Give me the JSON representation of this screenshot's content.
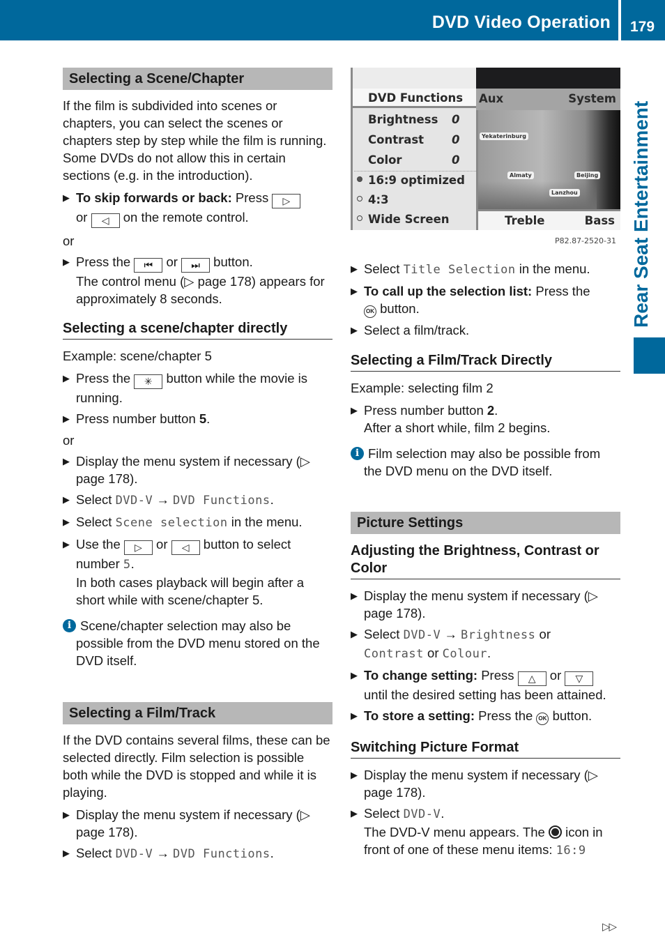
{
  "header": {
    "title": "DVD Video Operation",
    "page_number": "179"
  },
  "side_tab": {
    "label": "Rear Seat Entertainment"
  },
  "colors": {
    "brand": "#00689c",
    "section_bg": "#b7b7b7"
  },
  "left": {
    "scene_section": {
      "heading": "Selecting a Scene/Chapter",
      "intro": "If the film is subdivided into scenes or chapters, you can select the scenes or chapters step by step while the film is running. Some DVDs do not allow this in certain sections (e.g. in the introduction).",
      "skip_bold": "To skip forwards or back:",
      "skip_press": "Press",
      "skip_or": "or",
      "skip_tail": "on the remote control.",
      "key_next": "▷",
      "key_prev": "◁",
      "or1": "or",
      "press_the": "Press the",
      "key_skip_back": "⏮",
      "mid_or": "or",
      "key_skip_fwd": "⏭",
      "button_word": "button.",
      "control_menu": "The control menu (▷ page 178) appears for approximately 8 seconds."
    },
    "direct_section": {
      "heading": "Selecting a scene/chapter directly",
      "example": "Example: scene/chapter 5",
      "star_pre": "Press the",
      "key_star": "✳",
      "star_post": "button while the movie is running.",
      "number_pre": "Press number button",
      "number_val": "5",
      "number_post": ".",
      "or": "or",
      "display_menu": "Display the menu system if necessary (▷ page 178).",
      "select_word": "Select",
      "path_dvdv": "DVD-V",
      "arrow": "→",
      "path_func": "DVD Functions",
      "period": ".",
      "select2_word": "Select",
      "scene_selection": "Scene selection",
      "in_menu": "in the menu.",
      "use_the": "Use the",
      "use_or": "or",
      "use_tail": "button to select number",
      "use_num": "5",
      "use_period": ".",
      "playback": "In both cases playback will begin after a short while with scene/chapter 5.",
      "note": "Scene/chapter selection may also be possible from the DVD menu stored on the DVD itself."
    },
    "film_section": {
      "heading": "Selecting a Film/Track",
      "intro": "If the DVD contains several films, these can be selected directly. Film selection is possible both while the DVD is stopped and while it is playing.",
      "display_menu": "Display the menu system if necessary (▷ page 178).",
      "select_word": "Select",
      "path_dvdv": "DVD-V",
      "arrow": "→",
      "path_func": "DVD Functions",
      "period": "."
    }
  },
  "screen": {
    "menu_title": "DVD Functions",
    "tab_aux": "Aux",
    "tab_system": "System",
    "rows": [
      {
        "label": "Brightness",
        "value": "0"
      },
      {
        "label": "Contrast",
        "value": "0"
      },
      {
        "label": "Color",
        "value": "0"
      }
    ],
    "formats": [
      {
        "label": "16:9 optimized",
        "selected": true
      },
      {
        "label": "4:3",
        "selected": false
      },
      {
        "label": "Wide Screen",
        "selected": false
      }
    ],
    "cities": [
      "Yekaterinburg",
      "Almaty",
      "Beijing",
      "Lanzhou"
    ],
    "tab_treble": "Treble",
    "tab_bass": "Bass",
    "image_code": "P82.87-2520-31"
  },
  "right": {
    "title_sel_pre": "Select",
    "title_selection": "Title Selection",
    "title_sel_post": "in the menu.",
    "call_bold": "To call up the selection list:",
    "call_tail": "Press the",
    "ok_label": "OK",
    "call_button": "button.",
    "select_film": "Select a film/track.",
    "direct_film": {
      "heading": "Selecting a Film/Track Directly",
      "example": "Example: selecting film 2",
      "number_pre": "Press number button",
      "number_val": "2",
      "number_post": ".",
      "after": "After a short while, film 2 begins.",
      "note": "Film selection may also be possible from the DVD menu on the DVD itself."
    },
    "picture": {
      "heading": "Picture Settings",
      "sub_heading": "Adjusting the Brightness, Contrast or Color",
      "display_menu": "Display the menu system if necessary (▷ page 178).",
      "select_word": "Select",
      "path_dvdv": "DVD-V",
      "arrow": "→",
      "brightness": "Brightness",
      "or1": "or",
      "contrast": "Contrast",
      "or2": "or",
      "colour": "Colour",
      "period": ".",
      "change_bold": "To change setting:",
      "change_press": "Press",
      "key_up": "△",
      "change_or": "or",
      "key_down": "▽",
      "change_tail": "until the desired setting has been attained.",
      "store_bold": "To store a setting:",
      "store_tail": "Press the",
      "store_button": "button."
    },
    "format": {
      "heading": "Switching Picture Format",
      "display_menu": "Display the menu system if necessary (▷ page 178).",
      "select_word": "Select",
      "path_dvdv": "DVD-V",
      "period": ".",
      "appears_pre": "The DVD-V menu appears. The",
      "appears_post": "icon in front of one of these menu items:",
      "item_169": "16:9"
    }
  },
  "footer": {
    "continue_mark": "▷▷"
  }
}
